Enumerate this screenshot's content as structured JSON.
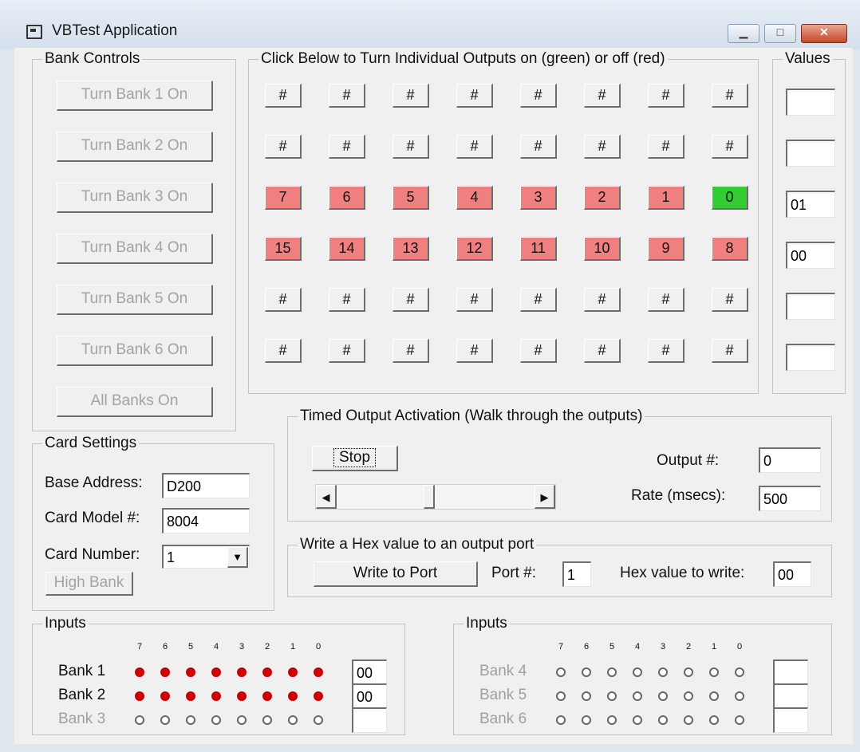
{
  "window": {
    "title": "VBTest Application",
    "min_glyph": "▁",
    "max_glyph": "□",
    "close_glyph": "✕"
  },
  "bank_controls": {
    "legend": "Bank Controls",
    "buttons": [
      "Turn Bank 1 On",
      "Turn Bank 2 On",
      "Turn Bank 3 On",
      "Turn Bank 4 On",
      "Turn Bank 5 On",
      "Turn Bank 6 On",
      "All Banks On"
    ]
  },
  "outputs": {
    "legend": "Click Below to Turn Individual Outputs on (green) or off (red)",
    "colors": {
      "on": "#33cc33",
      "off": "#f08080"
    },
    "rows": [
      [
        {
          "label": "#",
          "state": "none"
        },
        {
          "label": "#",
          "state": "none"
        },
        {
          "label": "#",
          "state": "none"
        },
        {
          "label": "#",
          "state": "none"
        },
        {
          "label": "#",
          "state": "none"
        },
        {
          "label": "#",
          "state": "none"
        },
        {
          "label": "#",
          "state": "none"
        },
        {
          "label": "#",
          "state": "none"
        }
      ],
      [
        {
          "label": "#",
          "state": "none"
        },
        {
          "label": "#",
          "state": "none"
        },
        {
          "label": "#",
          "state": "none"
        },
        {
          "label": "#",
          "state": "none"
        },
        {
          "label": "#",
          "state": "none"
        },
        {
          "label": "#",
          "state": "none"
        },
        {
          "label": "#",
          "state": "none"
        },
        {
          "label": "#",
          "state": "none"
        }
      ],
      [
        {
          "label": "7",
          "state": "off"
        },
        {
          "label": "6",
          "state": "off"
        },
        {
          "label": "5",
          "state": "off"
        },
        {
          "label": "4",
          "state": "off"
        },
        {
          "label": "3",
          "state": "off"
        },
        {
          "label": "2",
          "state": "off"
        },
        {
          "label": "1",
          "state": "off"
        },
        {
          "label": "0",
          "state": "on"
        }
      ],
      [
        {
          "label": "15",
          "state": "off"
        },
        {
          "label": "14",
          "state": "off"
        },
        {
          "label": "13",
          "state": "off"
        },
        {
          "label": "12",
          "state": "off"
        },
        {
          "label": "11",
          "state": "off"
        },
        {
          "label": "10",
          "state": "off"
        },
        {
          "label": "9",
          "state": "off"
        },
        {
          "label": "8",
          "state": "off"
        }
      ],
      [
        {
          "label": "#",
          "state": "none"
        },
        {
          "label": "#",
          "state": "none"
        },
        {
          "label": "#",
          "state": "none"
        },
        {
          "label": "#",
          "state": "none"
        },
        {
          "label": "#",
          "state": "none"
        },
        {
          "label": "#",
          "state": "none"
        },
        {
          "label": "#",
          "state": "none"
        },
        {
          "label": "#",
          "state": "none"
        }
      ],
      [
        {
          "label": "#",
          "state": "none"
        },
        {
          "label": "#",
          "state": "none"
        },
        {
          "label": "#",
          "state": "none"
        },
        {
          "label": "#",
          "state": "none"
        },
        {
          "label": "#",
          "state": "none"
        },
        {
          "label": "#",
          "state": "none"
        },
        {
          "label": "#",
          "state": "none"
        },
        {
          "label": "#",
          "state": "none"
        }
      ]
    ]
  },
  "values": {
    "legend": "Values",
    "items": [
      "",
      "",
      "01",
      "00",
      "",
      ""
    ]
  },
  "card_settings": {
    "legend": "Card Settings",
    "base_address_label": "Base Address:",
    "base_address": "D200",
    "card_model_label": "Card Model #:",
    "card_model": "8004",
    "card_number_label": "Card Number:",
    "card_number": "1",
    "high_bank_label": "High Bank",
    "dropdown_glyph": "▼"
  },
  "timed": {
    "legend": "Timed Output Activation  (Walk through the outputs)",
    "stop_label": "Stop",
    "output_label": "Output #:",
    "output_value": "0",
    "rate_label": "Rate (msecs):",
    "rate_value": "500",
    "scroll_left_glyph": "◀",
    "scroll_right_glyph": "▶",
    "scroll_position": 0.46
  },
  "write_hex": {
    "legend": "Write a Hex value to an output port",
    "button_label": "Write to Port",
    "port_label": "Port #:",
    "port_value": "1",
    "hex_label": "Hex value to write:",
    "hex_value": "00"
  },
  "inputs_left": {
    "legend": "Inputs",
    "bits": [
      "7",
      "6",
      "5",
      "4",
      "3",
      "2",
      "1",
      "0"
    ],
    "banks": [
      {
        "label": "Bank 1",
        "active": true,
        "leds": [
          1,
          1,
          1,
          1,
          1,
          1,
          1,
          1
        ],
        "value": "00"
      },
      {
        "label": "Bank 2",
        "active": true,
        "leds": [
          1,
          1,
          1,
          1,
          1,
          1,
          1,
          1
        ],
        "value": "00"
      },
      {
        "label": "Bank 3",
        "active": false,
        "leds": [
          0,
          0,
          0,
          0,
          0,
          0,
          0,
          0
        ],
        "value": ""
      }
    ]
  },
  "inputs_right": {
    "legend": "Inputs",
    "bits": [
      "7",
      "6",
      "5",
      "4",
      "3",
      "2",
      "1",
      "0"
    ],
    "banks": [
      {
        "label": "Bank 4",
        "active": false,
        "leds": [
          0,
          0,
          0,
          0,
          0,
          0,
          0,
          0
        ],
        "value": ""
      },
      {
        "label": "Bank 5",
        "active": false,
        "leds": [
          0,
          0,
          0,
          0,
          0,
          0,
          0,
          0
        ],
        "value": ""
      },
      {
        "label": "Bank 6",
        "active": false,
        "leds": [
          0,
          0,
          0,
          0,
          0,
          0,
          0,
          0
        ],
        "value": ""
      }
    ]
  }
}
